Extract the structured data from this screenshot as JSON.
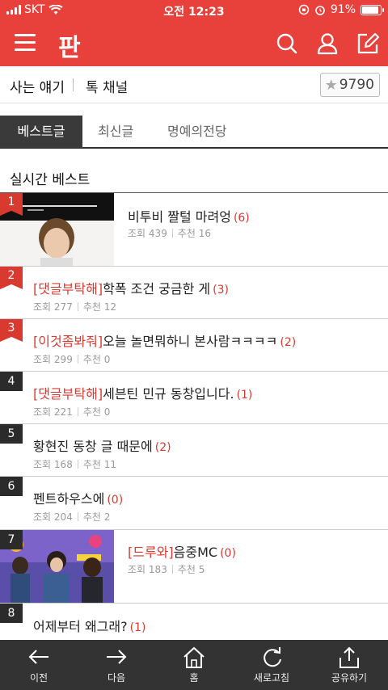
{
  "status_bar": {
    "carrier": "SKT",
    "time": "오전 12:23",
    "battery": "91%",
    "battery_level": 0.91
  },
  "header": {
    "logo": "판",
    "menu_icon": "hamburger-menu-icon",
    "icons": [
      "search-icon",
      "user-icon",
      "compose-icon"
    ]
  },
  "channel": {
    "title": "사는 얘기",
    "sub": "톡 채널",
    "favorite_count": "9790"
  },
  "tabs": [
    {
      "label": "베스트글",
      "active": true
    },
    {
      "label": "최신글",
      "active": false
    },
    {
      "label": "명예의전당",
      "active": false
    }
  ],
  "section_title": "실시간 베스트",
  "posts": [
    {
      "rank": "1",
      "tag": "",
      "title": "비투비 짤털 마려엉",
      "count": "(6)",
      "views_label": "조회",
      "views": "439",
      "recs_label": "추천",
      "recs": "16",
      "has_thumb": true
    },
    {
      "rank": "2",
      "tag": "[댓글부탁해]",
      "title": "학폭 조건 궁금한 게",
      "count": "(3)",
      "views_label": "조회",
      "views": "277",
      "recs_label": "추천",
      "recs": "12",
      "has_thumb": false
    },
    {
      "rank": "3",
      "tag": "[이것좀봐줘]",
      "title": "오늘 놀면뭐하니 본사람ㅋㅋㅋㅋ",
      "count": "(2)",
      "views_label": "조회",
      "views": "299",
      "recs_label": "추천",
      "recs": "0",
      "has_thumb": false
    },
    {
      "rank": "4",
      "tag": "[댓글부탁해]",
      "title": "세븐틴 민규 동창입니다.",
      "count": "(1)",
      "views_label": "조회",
      "views": "221",
      "recs_label": "추천",
      "recs": "0",
      "has_thumb": false
    },
    {
      "rank": "5",
      "tag": "",
      "title": "황현진 동창 글 때문에",
      "count": "(2)",
      "views_label": "조회",
      "views": "168",
      "recs_label": "추천",
      "recs": "11",
      "has_thumb": false
    },
    {
      "rank": "6",
      "tag": "",
      "title": "펜트하우스에",
      "count": "(0)",
      "views_label": "조회",
      "views": "204",
      "recs_label": "추천",
      "recs": "2",
      "has_thumb": false
    },
    {
      "rank": "7",
      "tag": "[드루와]",
      "title": "음중MC",
      "count": "(0)",
      "views_label": "조회",
      "views": "183",
      "recs_label": "추천",
      "recs": "5",
      "has_thumb": true
    },
    {
      "rank": "8",
      "tag": "",
      "title": "어제부터 왜그래?",
      "count": "(1)",
      "views_label": "",
      "views": "",
      "recs_label": "",
      "recs": "",
      "has_thumb": false
    }
  ],
  "bottom_nav": [
    {
      "label": "이전",
      "icon": "back-arrow-icon"
    },
    {
      "label": "다음",
      "icon": "forward-arrow-icon"
    },
    {
      "label": "홈",
      "icon": "home-icon"
    },
    {
      "label": "새로고침",
      "icon": "refresh-icon"
    },
    {
      "label": "공유하기",
      "icon": "share-icon"
    }
  ],
  "colors": {
    "brand": "#e8413c",
    "accent": "#d93a2f",
    "nav_bg": "#333333"
  }
}
